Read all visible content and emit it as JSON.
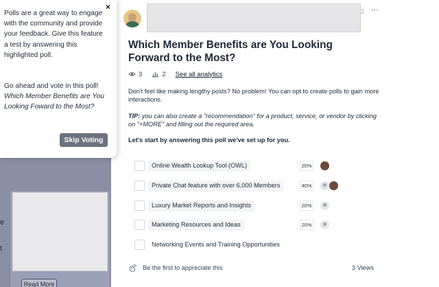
{
  "popover": {
    "close_icon": "×",
    "text_1": "Polls are a great way to engage with the community and provide your feedback. Give this feature a test by answering this highlighted poll.",
    "text_2": "Go ahead and vote in this poll!",
    "text_2_italic": "Which Member Benefits are You Looking Foward to the Most?",
    "skip_label": "Skip Voting"
  },
  "sidebar": {
    "edge_char_1": "e",
    "edge_char_2": "t",
    "read_more": "Read More"
  },
  "post": {
    "header_num": "2",
    "more_icon": "⋮",
    "title": "Which Member Benefits are You Looking Forward to the Most?",
    "views_count": "3",
    "votes_count": "2",
    "analytics_link": "See all analytics",
    "description": "Don't feel like making lengthy posts? No problem! You can opt to create polls to gain more interactions.",
    "tip_label": "TIP:",
    "tip_text": " you can also create a \"recommendation\" for a product, service, or vendor by clicking on \"+MORE\" and filling out the required area.",
    "lead": "Let's start by answering this poll we've set up for you."
  },
  "poll": {
    "options": [
      {
        "label": "Online Wealth Lookup Tool (OWL)",
        "percent": "20%",
        "share": 0.2,
        "voters": [
          "photo"
        ]
      },
      {
        "label": "Private Chat feature with over 6,000 Members",
        "percent": "40%",
        "share": 0.4,
        "voters": [
          "anon",
          "photo"
        ]
      },
      {
        "label": "Luxury Market Reports and Insights",
        "percent": "20%",
        "share": 0.2,
        "voters": [
          "anon"
        ]
      },
      {
        "label": "Marketing Resources and Ideas",
        "percent": "20%",
        "share": 0.2,
        "voters": [
          "anon"
        ]
      },
      {
        "label": "Networking Events and Training Opportunities",
        "percent": "",
        "share": 0,
        "voters": []
      }
    ]
  },
  "footer": {
    "appreciate": "Be the first to appreciate this",
    "views": "3 Views"
  },
  "icons": {
    "views": "eye-icon",
    "votes": "poll-icon",
    "appreciate": "clap-icon",
    "close": "close-icon",
    "more": "more-vertical-icon"
  }
}
